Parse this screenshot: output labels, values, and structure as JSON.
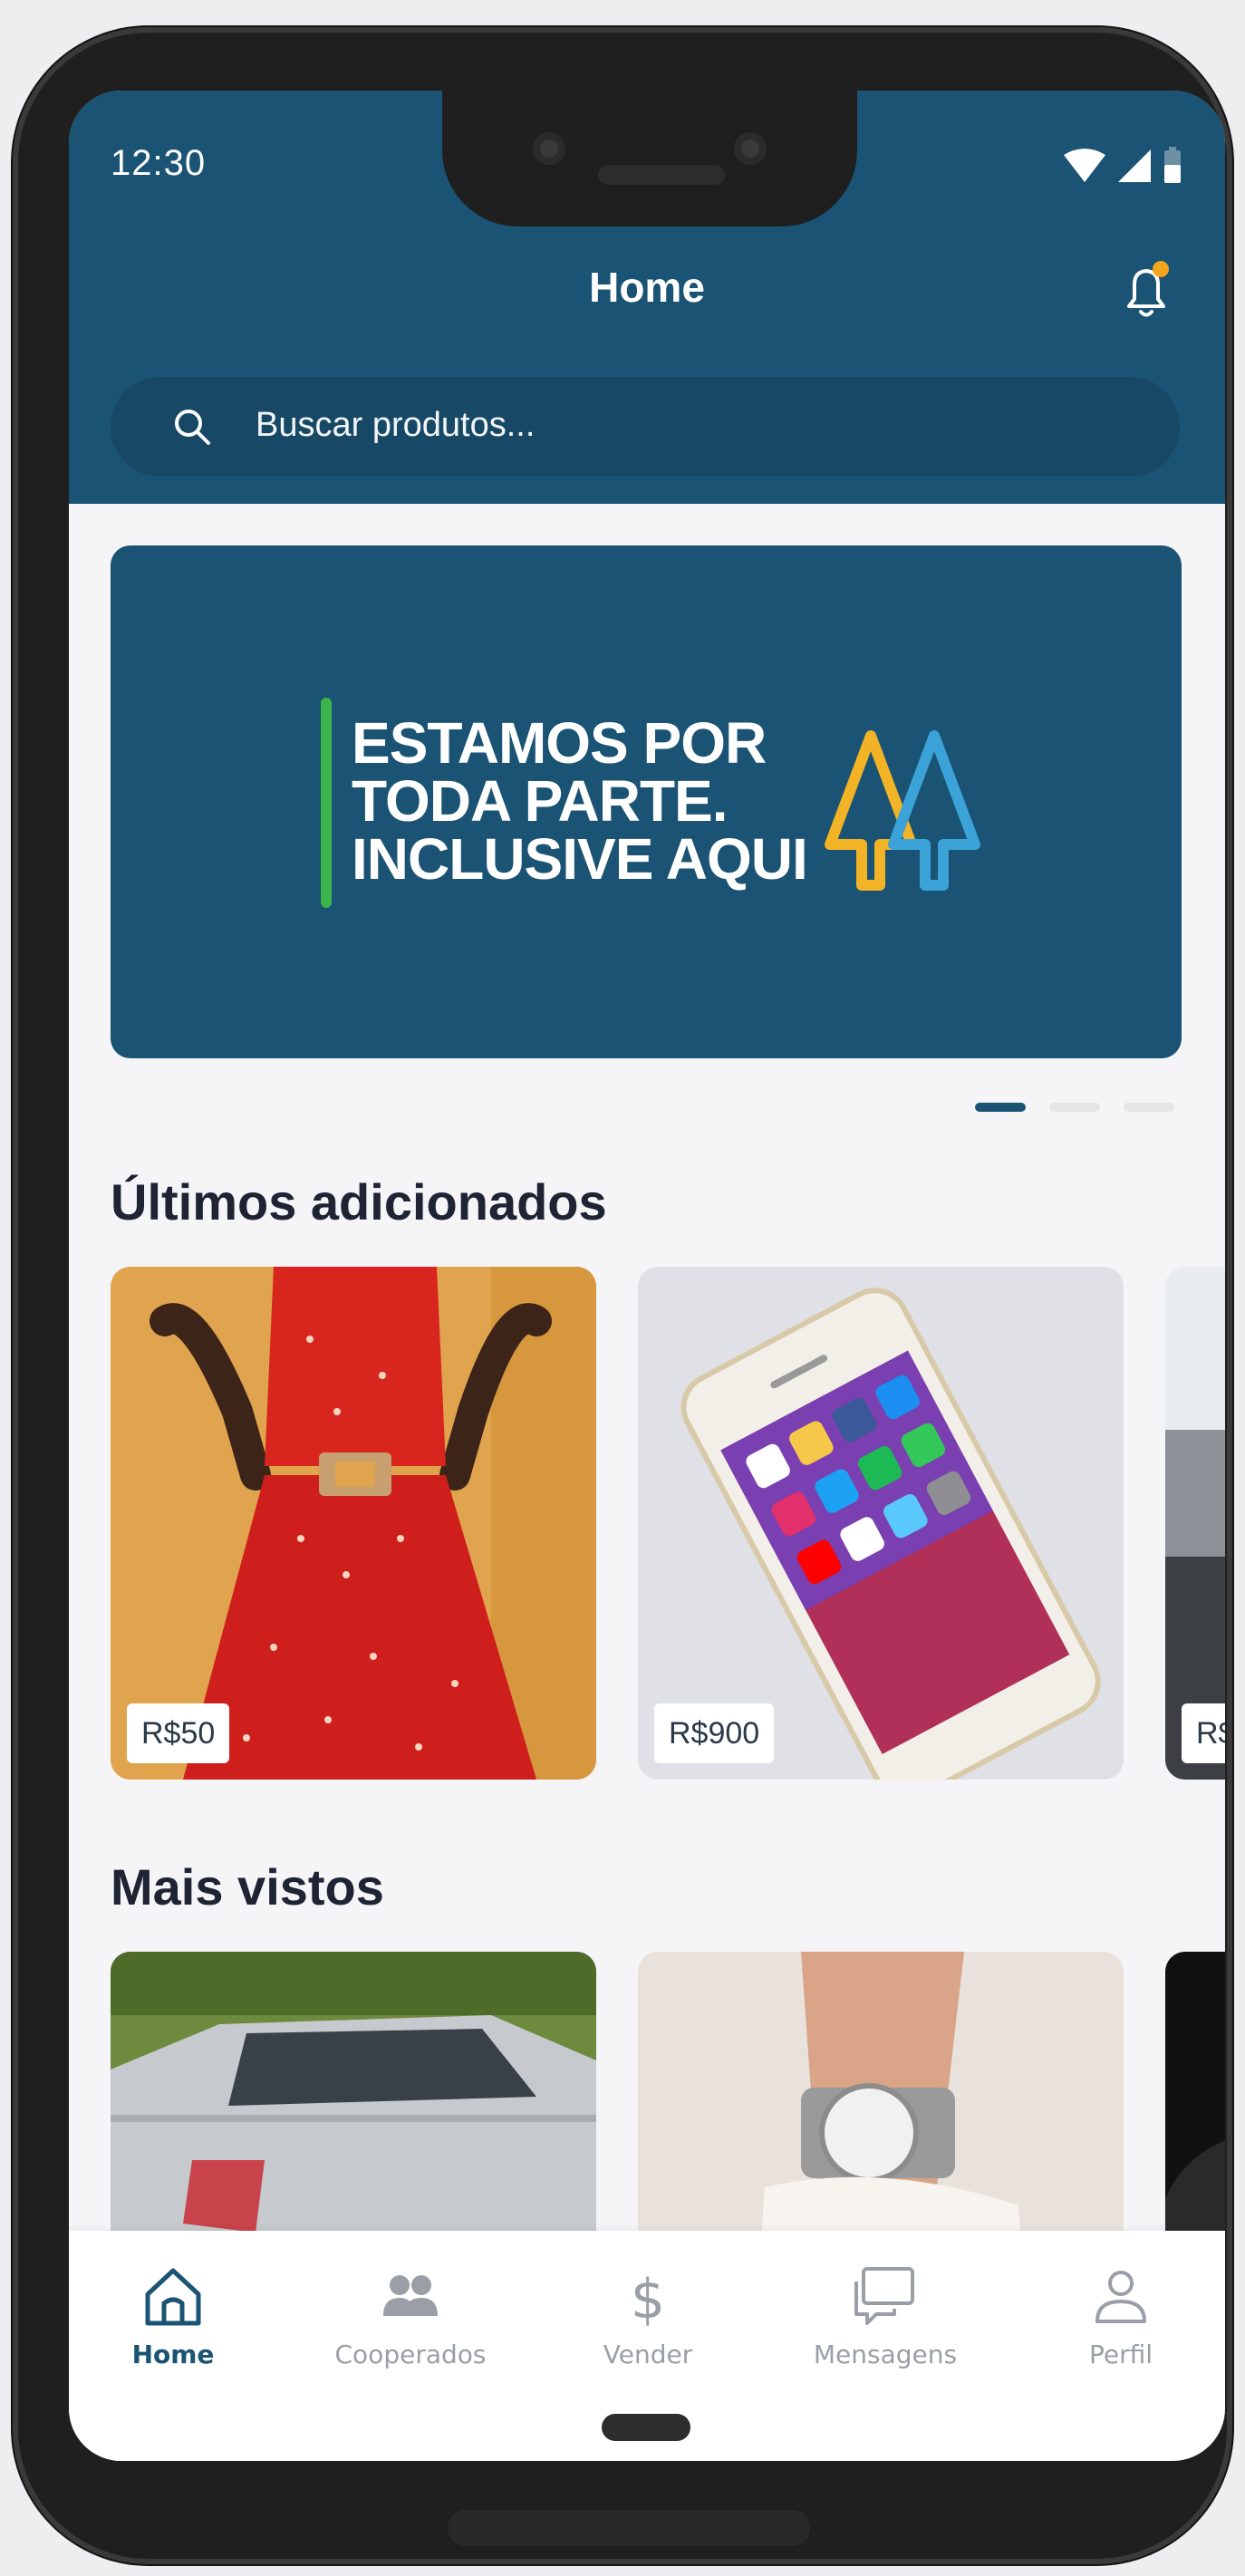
{
  "status_bar": {
    "time": "12:30"
  },
  "header": {
    "title": "Home",
    "search_placeholder": "Buscar produtos..."
  },
  "banner": {
    "lines": [
      "ESTAMOS POR",
      "TODA PARTE.",
      "INCLUSIVE AQUI"
    ],
    "pages": 3,
    "active_page": 1
  },
  "sections": {
    "latest": {
      "title": "Últimos adicionados",
      "items": [
        {
          "image": "red-dress-photo",
          "price": "R$50"
        },
        {
          "image": "smartphone-photo",
          "price": "R$900"
        },
        {
          "image": "partial-item-photo",
          "price": "R$"
        }
      ]
    },
    "most_viewed": {
      "title": "Mais vistos",
      "items": [
        {
          "image": "silver-car-photo"
        },
        {
          "image": "wristwatch-photo"
        },
        {
          "image": "partial-item-photo"
        }
      ]
    }
  },
  "bottom_nav": {
    "items": [
      {
        "label": "Home",
        "icon": "home-icon",
        "active": true
      },
      {
        "label": "Cooperados",
        "icon": "users-icon",
        "active": false
      },
      {
        "label": "Vender",
        "icon": "dollar-icon",
        "active": false
      },
      {
        "label": "Mensagens",
        "icon": "chat-icon",
        "active": false
      },
      {
        "label": "Perfil",
        "icon": "profile-icon",
        "active": false
      }
    ]
  },
  "colors": {
    "brand": "#1a5373",
    "notification_dot": "#f2a51d",
    "banner_accent_green": "#3cb54a",
    "logo_yellow": "#f3b326",
    "logo_blue": "#3ba3d8"
  }
}
